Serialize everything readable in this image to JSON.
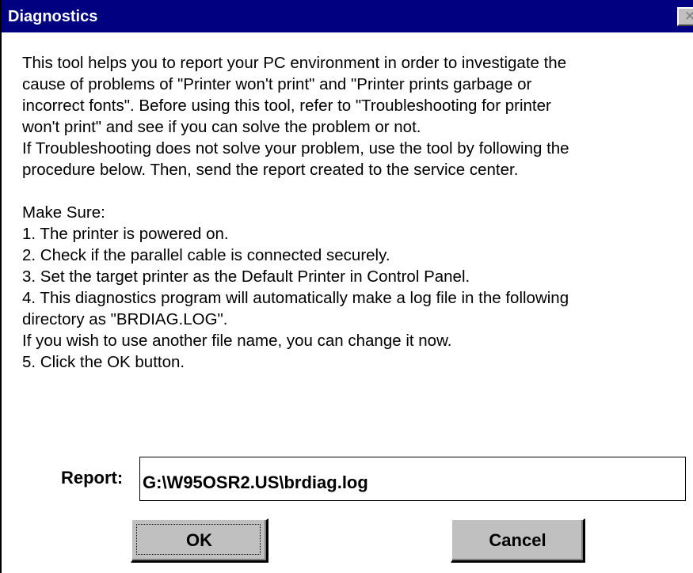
{
  "window": {
    "title": "Diagnostics",
    "close_symbol": "✕"
  },
  "description": {
    "lines": [
      "This tool helps you to report your PC environment in order to investigate the",
      "cause of  problems of \"Printer won't print\" and \"Printer prints garbage or",
      "incorrect fonts\". Before using this tool, refer to \"Troubleshooting for printer",
      "won't print\" and see if you can solve the problem or not.",
      "If Troubleshooting does not solve your problem, use the tool by following the",
      "procedure below. Then, send the report created to the service center."
    ],
    "make_sure_heading": "Make Sure:",
    "steps": [
      "1. The printer is powered on.",
      "2. Check if the parallel cable is connected securely.",
      "3. Set the target printer as the Default Printer in Control Panel.",
      "4. This diagnostics program will automatically make a log file in the following",
      "directory as \"BRDIAG.LOG\".",
      "If you wish to use another file name, you can change it now.",
      "5. Click the OK button."
    ]
  },
  "report": {
    "label": "Report:",
    "value": "G:\\W95OSR2.US\\brdiag.log"
  },
  "buttons": {
    "ok": "OK",
    "cancel": "Cancel"
  },
  "colors": {
    "titlebar": "#000080",
    "button_face": "#c0c0c0",
    "background": "#ffffff"
  }
}
